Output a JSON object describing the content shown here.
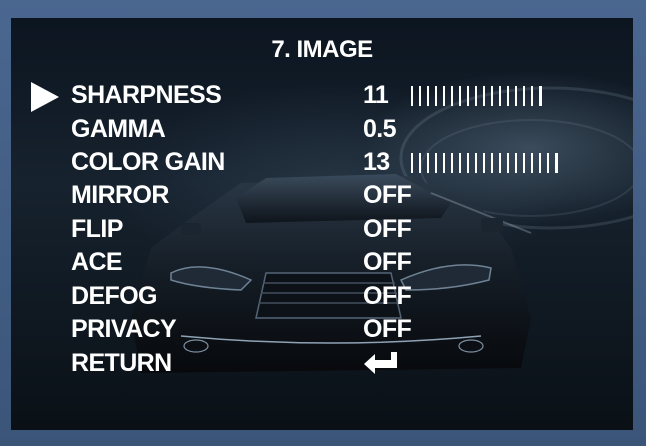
{
  "menu": {
    "title": "7. IMAGE",
    "items": [
      {
        "label": "SHARPNESS",
        "value": "11",
        "bar_level": 11,
        "bar_max": 20,
        "selected": true
      },
      {
        "label": "GAMMA",
        "value": "0.5"
      },
      {
        "label": "COLOR GAIN",
        "value": "13",
        "bar_level": 13,
        "bar_max": 20
      },
      {
        "label": "MIRROR",
        "value": "OFF"
      },
      {
        "label": "FLIP",
        "value": "OFF"
      },
      {
        "label": "ACE",
        "value": "OFF"
      },
      {
        "label": "DEFOG",
        "value": "OFF"
      },
      {
        "label": "PRIVACY",
        "value": "OFF"
      },
      {
        "label": "RETURN",
        "value_icon": "return-arrow-icon"
      }
    ]
  },
  "colors": {
    "frame": "#3d5a80",
    "text": "#ffffff",
    "screen_background": "#0c1520"
  }
}
